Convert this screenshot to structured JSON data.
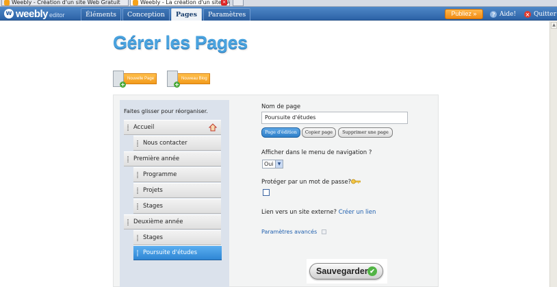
{
  "browser": {
    "tabs": [
      {
        "title": "Weebly - Création d'un site Web Gratuit"
      },
      {
        "title": "Weebly - La création d'un site Web..."
      }
    ]
  },
  "toolbar": {
    "logo": "weebly",
    "logo_sub": "editor",
    "tabs": [
      {
        "label": "Éléments",
        "active": false
      },
      {
        "label": "Conception",
        "active": false
      },
      {
        "label": "Pages",
        "active": true
      },
      {
        "label": "Paramètres",
        "active": false
      }
    ],
    "publish_label": "Publiez »",
    "help_label": "Aide!",
    "quit_label": "Quitter"
  },
  "page": {
    "title": "Gérer les Pages",
    "new_page_label": "Nouvelle Page",
    "new_blog_label": "Nouveau Blog"
  },
  "tree": {
    "hint": "Faites glisser pour réorganiser.",
    "items": [
      {
        "label": "Accueil",
        "level": 0,
        "selected": false,
        "home": true
      },
      {
        "label": "Nous contacter",
        "level": 1,
        "selected": false
      },
      {
        "label": "Première année",
        "level": 0,
        "selected": false
      },
      {
        "label": "Programme",
        "level": 1,
        "selected": false
      },
      {
        "label": "Projets",
        "level": 1,
        "selected": false
      },
      {
        "label": "Stages",
        "level": 1,
        "selected": false
      },
      {
        "label": "Deuxième année",
        "level": 0,
        "selected": false
      },
      {
        "label": "Stages",
        "level": 1,
        "selected": false
      },
      {
        "label": "Poursuite d'études",
        "level": 1,
        "selected": true
      }
    ]
  },
  "form": {
    "name_label": "Nom de page",
    "name_value": "Poursuite d'études",
    "edit_button": "Page d'édition",
    "copy_button": "Copier page",
    "delete_button": "Supprimer une page",
    "nav_label": "Afficher dans le menu de navigation ?",
    "nav_value": "Oui",
    "password_label": "Protéger par un mot de passe?",
    "external_label": "Lien vers un site externe?",
    "external_link": "Créer un lien",
    "advanced_label": "Paramètres avancés",
    "save_label": "Sauvegarder"
  },
  "colors": {
    "toolbar": "#2c62a6",
    "title": "#4aa3df",
    "selected_row": "#2f86d4",
    "publish": "#f08a12"
  }
}
